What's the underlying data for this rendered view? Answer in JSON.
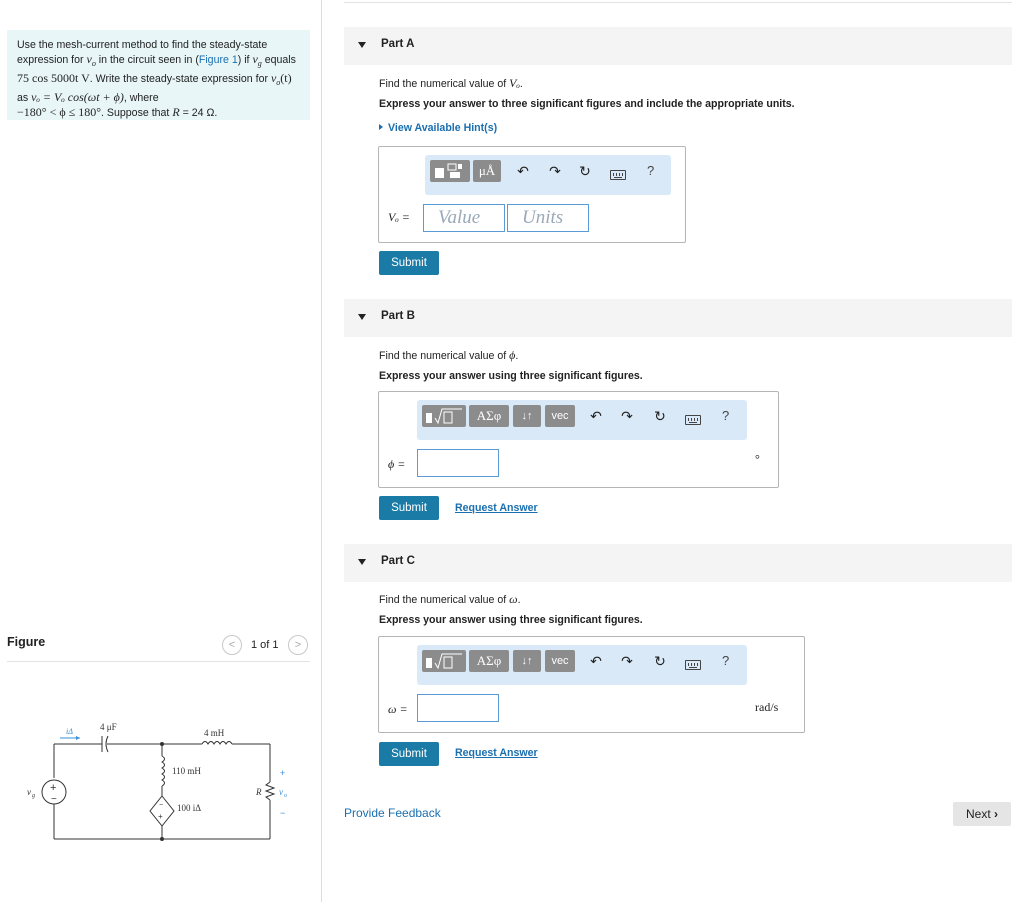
{
  "problem": {
    "text_1": "Use the mesh-current method to find the steady-state expression for ",
    "vo_sym": "v",
    "vo_sub": "o",
    "text_2": " in the circuit seen in (",
    "figure_link": "Figure 1",
    "text_3": ") if ",
    "vg_sym": "v",
    "vg_sub": "g",
    "text_4": " equals ",
    "source_expr": "75 cos 5000t V",
    "text_5": ". Write the steady-state expression for ",
    "vo_t": "v",
    "vo_t_sub": "o",
    "vo_t_arg": "(t)",
    "text_6": " as ",
    "form_expr": "vₒ = Vₒ cos(ωt + ϕ)",
    "text_7": ", where",
    "range_expr": "−180° < ϕ ≤ 180°",
    "text_8": ". Suppose that ",
    "r_expr": "R",
    "text_9": " = 24 Ω."
  },
  "figure": {
    "title": "Figure",
    "pager": "1 of 1",
    "prev_icon": "chevron-left-icon",
    "next_icon": "chevron-right-icon",
    "labels": {
      "cap": "4 μF",
      "ind1": "4 mH",
      "ind2": "110 mH",
      "dep_source": "100 iΔ",
      "r": "R",
      "vg": "v",
      "vg_sub": "g",
      "vo": "v",
      "vo_sub": "o",
      "i_delta": "iΔ",
      "plus": "+",
      "minus": "−"
    }
  },
  "parts": [
    {
      "label": "Part A",
      "question_pre": "Find the numerical value of ",
      "question_var": "Vₒ",
      "question_post": ".",
      "instruction": "Express your answer to three significant figures and include the appropriate units.",
      "hint": "View Available Hint(s)",
      "var_label": "Vₒ =",
      "value_placeholder": "Value",
      "units_placeholder": "Units",
      "submit": "Submit",
      "toolbar": {
        "units_btn": "μÅ",
        "help": "?"
      }
    },
    {
      "label": "Part B",
      "question_pre": "Find the numerical value of ",
      "question_var": "ϕ",
      "question_post": ".",
      "instruction": "Express your answer using three significant figures.",
      "var_label": "ϕ =",
      "unit": "°",
      "submit": "Submit",
      "request": "Request Answer",
      "toolbar": {
        "greek": "ΑΣφ",
        "sort": "↓↑",
        "vec": "vec",
        "help": "?"
      }
    },
    {
      "label": "Part C",
      "question_pre": "Find the numerical value of ",
      "question_var": "ω",
      "question_post": ".",
      "instruction": "Express your answer using three significant figures.",
      "var_label": "ω =",
      "unit": "rad/s",
      "submit": "Submit",
      "request": "Request Answer",
      "toolbar": {
        "greek": "ΑΣφ",
        "sort": "↓↑",
        "vec": "vec",
        "help": "?"
      }
    }
  ],
  "footer": {
    "feedback": "Provide Feedback",
    "next": "Next"
  },
  "colors": {
    "accent": "#1a7ba6",
    "link": "#1a6fb0",
    "toolbar": "#d9e9f7",
    "problem_bg": "#e8f6f8"
  }
}
